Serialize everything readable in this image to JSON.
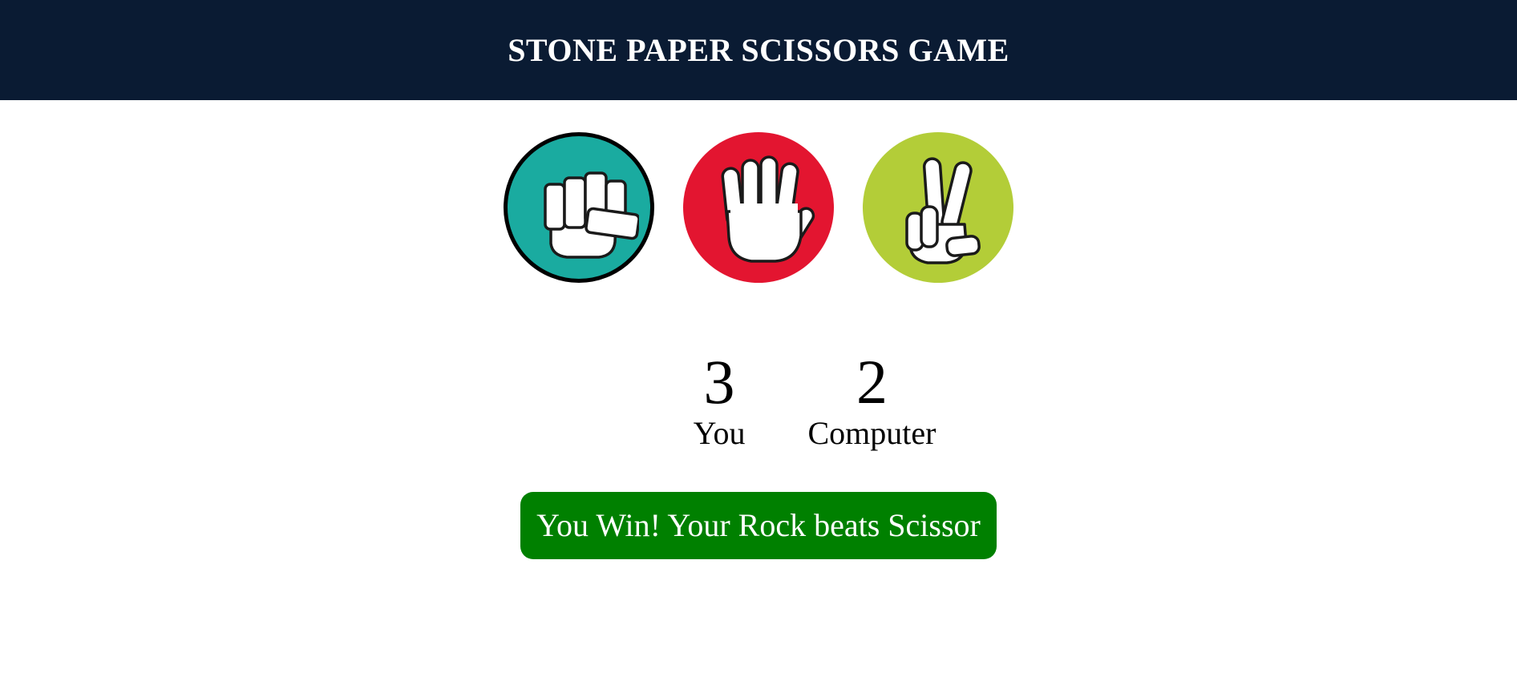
{
  "header": {
    "title": "STONE PAPER SCISSORS GAME"
  },
  "choices": [
    {
      "id": "rock",
      "icon": "rock-fist-icon",
      "color": "#1aaba0",
      "selected": true
    },
    {
      "id": "paper",
      "icon": "paper-hand-icon",
      "color": "#e31530",
      "selected": false
    },
    {
      "id": "scissors",
      "icon": "scissors-hand-icon",
      "color": "#b3cd38",
      "selected": false
    }
  ],
  "scores": {
    "user": {
      "value": "3",
      "label": "You"
    },
    "computer": {
      "value": "2",
      "label": "Computer"
    }
  },
  "message": {
    "text": "You Win! Your Rock beats Scissor",
    "color": "#008000"
  },
  "colors": {
    "header_bg": "#0a1b33"
  }
}
